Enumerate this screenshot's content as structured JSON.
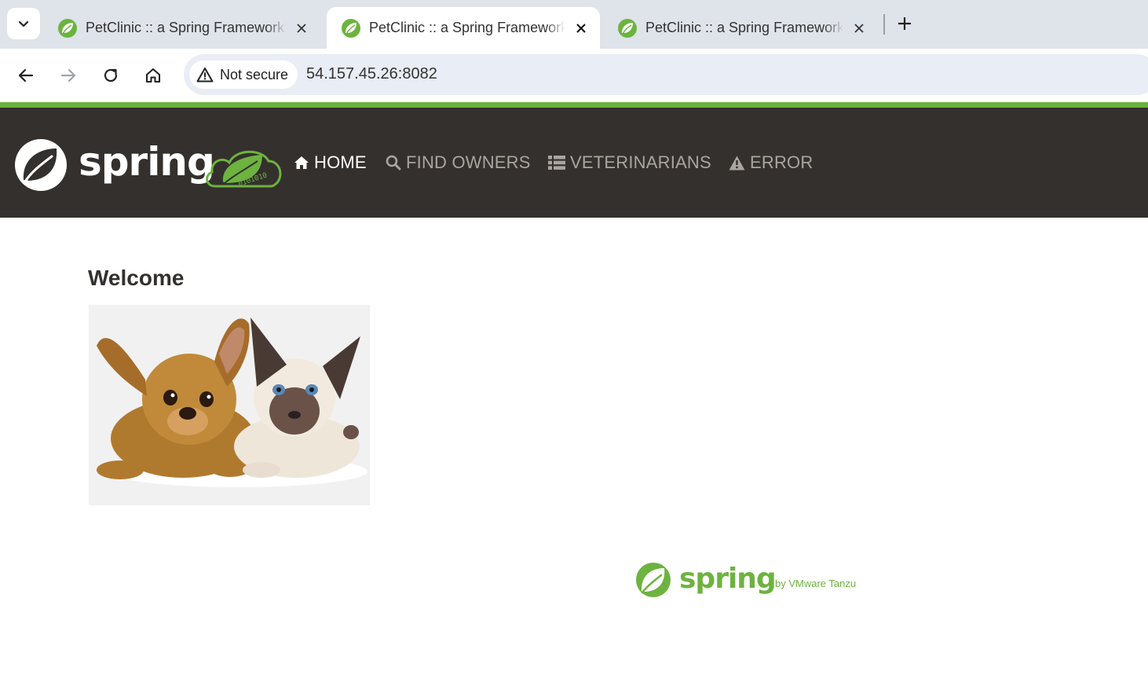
{
  "browser": {
    "tabs": [
      {
        "title": "PetClinic :: a Spring Framework demonstration",
        "active": false
      },
      {
        "title": "PetClinic :: a Spring Framework demonstration",
        "active": true
      },
      {
        "title": "PetClinic :: a Spring Framework demonstration",
        "active": false
      }
    ],
    "security_label": "Not secure",
    "url": "54.157.45.26:8082"
  },
  "site": {
    "nav": [
      {
        "label": "Home",
        "icon": "home-icon",
        "active": true
      },
      {
        "label": "Find owners",
        "icon": "search-icon",
        "active": false
      },
      {
        "label": "Veterinarians",
        "icon": "list-icon",
        "active": false
      },
      {
        "label": "Error",
        "icon": "warning-icon",
        "active": false
      }
    ],
    "logo_text": "spring",
    "logo_badge_text": "0101010",
    "heading": "Welcome",
    "footer_logo_text": "spring",
    "footer_by": "by VMware Tanzu"
  },
  "colors": {
    "brand_green": "#6db33f",
    "navbar_bg": "#34302d",
    "nav_inactive": "#aaa59f"
  }
}
